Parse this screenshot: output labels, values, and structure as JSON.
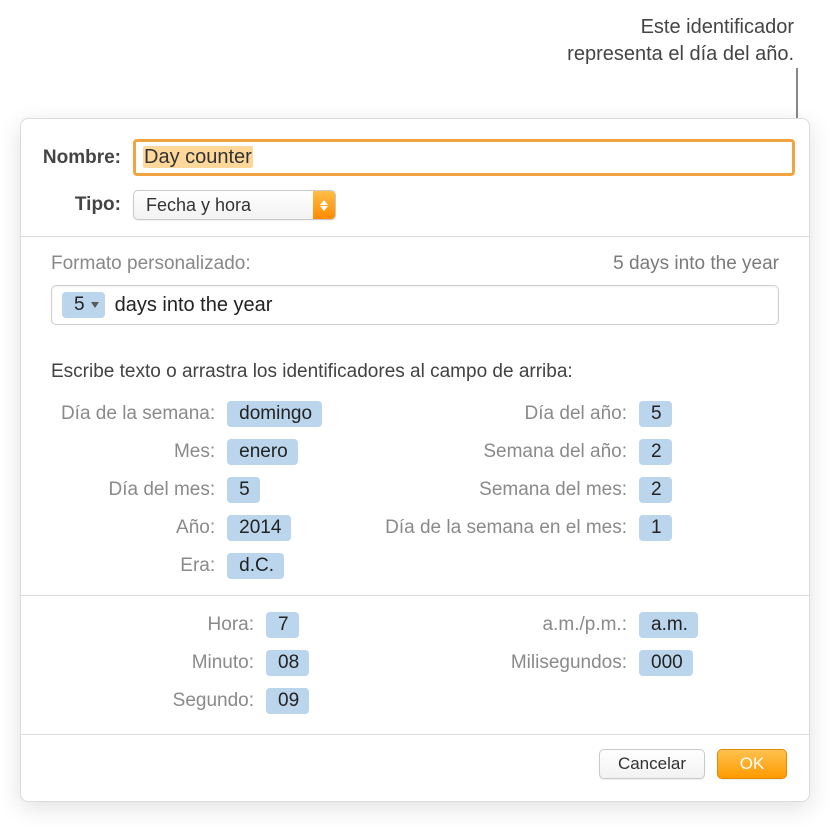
{
  "callout": {
    "line1": "Este identificador",
    "line2": "representa el día del año."
  },
  "labels": {
    "name": "Nombre:",
    "type": "Tipo:"
  },
  "name_value": "Day counter",
  "type_value": "Fecha y hora",
  "format": {
    "label": "Formato personalizado:",
    "preview": "5 days into the year",
    "token_value": "5",
    "free_text": "days into the year"
  },
  "instruction": "Escribe texto o arrastra los identificadores al campo de arriba:",
  "date_tokens_left": [
    {
      "label": "Día de la semana:",
      "value": "domingo"
    },
    {
      "label": "Mes:",
      "value": "enero"
    },
    {
      "label": "Día del mes:",
      "value": "5"
    },
    {
      "label": "Año:",
      "value": "2014"
    },
    {
      "label": "Era:",
      "value": "d.C."
    }
  ],
  "date_tokens_right": [
    {
      "label": "Día del año:",
      "value": "5"
    },
    {
      "label": "Semana del año:",
      "value": "2"
    },
    {
      "label": "Semana del mes:",
      "value": "2"
    },
    {
      "label": "Día de la semana en el mes:",
      "value": "1"
    }
  ],
  "time_tokens_left": [
    {
      "label": "Hora:",
      "value": "7"
    },
    {
      "label": "Minuto:",
      "value": "08"
    },
    {
      "label": "Segundo:",
      "value": "09"
    }
  ],
  "time_tokens_right": [
    {
      "label": "a.m./p.m.:",
      "value": "a.m."
    },
    {
      "label": "Milisegundos:",
      "value": "000"
    }
  ],
  "buttons": {
    "cancel": "Cancelar",
    "ok": "OK"
  }
}
